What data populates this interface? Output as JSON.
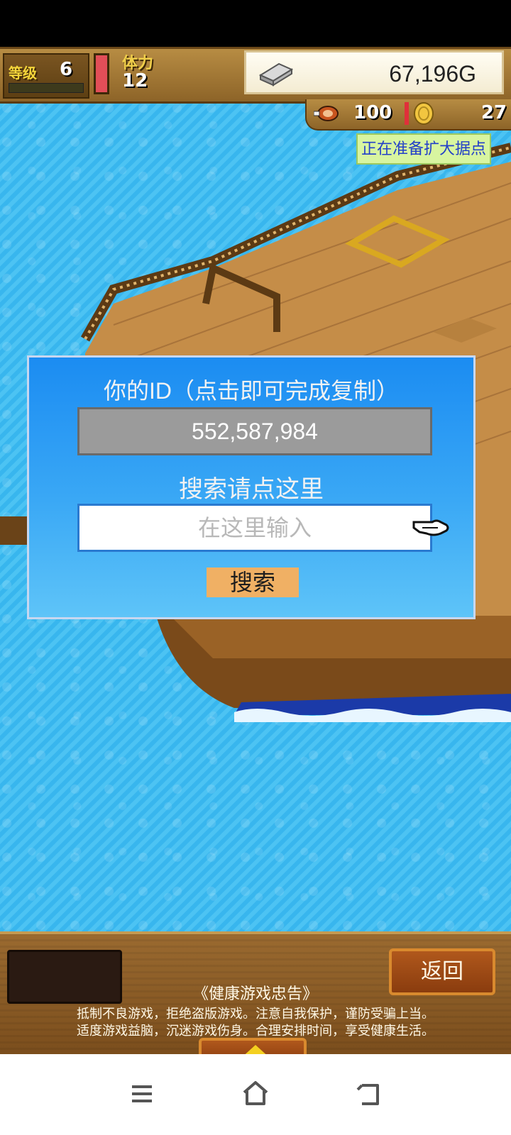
{
  "hud": {
    "level_label": "等级",
    "level_value": "6",
    "stamina_label": "体力",
    "stamina_value": "12",
    "gold_value": "67,196G",
    "food_value": "100",
    "coin_value": "27",
    "status_banner": "正在准备扩大据点"
  },
  "dialog": {
    "id_title": "你的ID（点击即可完成复制）",
    "id_value": "552,587,984",
    "search_title": "搜索请点这里",
    "search_placeholder": "在这里输入",
    "search_button": "搜索"
  },
  "bottom": {
    "back_button": "返回",
    "notice_title": "《健康游戏忠告》",
    "notice_line1": "抵制不良游戏，拒绝盗版游戏。注意自我保护，谨防受骗上当。",
    "notice_line2": "适度游戏益脑，沉迷游戏伤身。合理安排时间，享受健康生活。"
  },
  "icons": {
    "gold": "silver-bar-icon",
    "food": "meat-icon",
    "coin": "coin-icon",
    "pointer": "pointing-hand-icon",
    "expand": "up-arrow-icon",
    "nav_menu": "menu-icon",
    "nav_home": "home-icon",
    "nav_back": "back-icon"
  },
  "colors": {
    "dialog_top": "#1b8cf2",
    "dialog_bottom": "#5ec4f8",
    "search_button": "#f0b064",
    "id_box": "#9b9b9b",
    "status_text": "#2340c8",
    "sea": "#3db8ef"
  }
}
